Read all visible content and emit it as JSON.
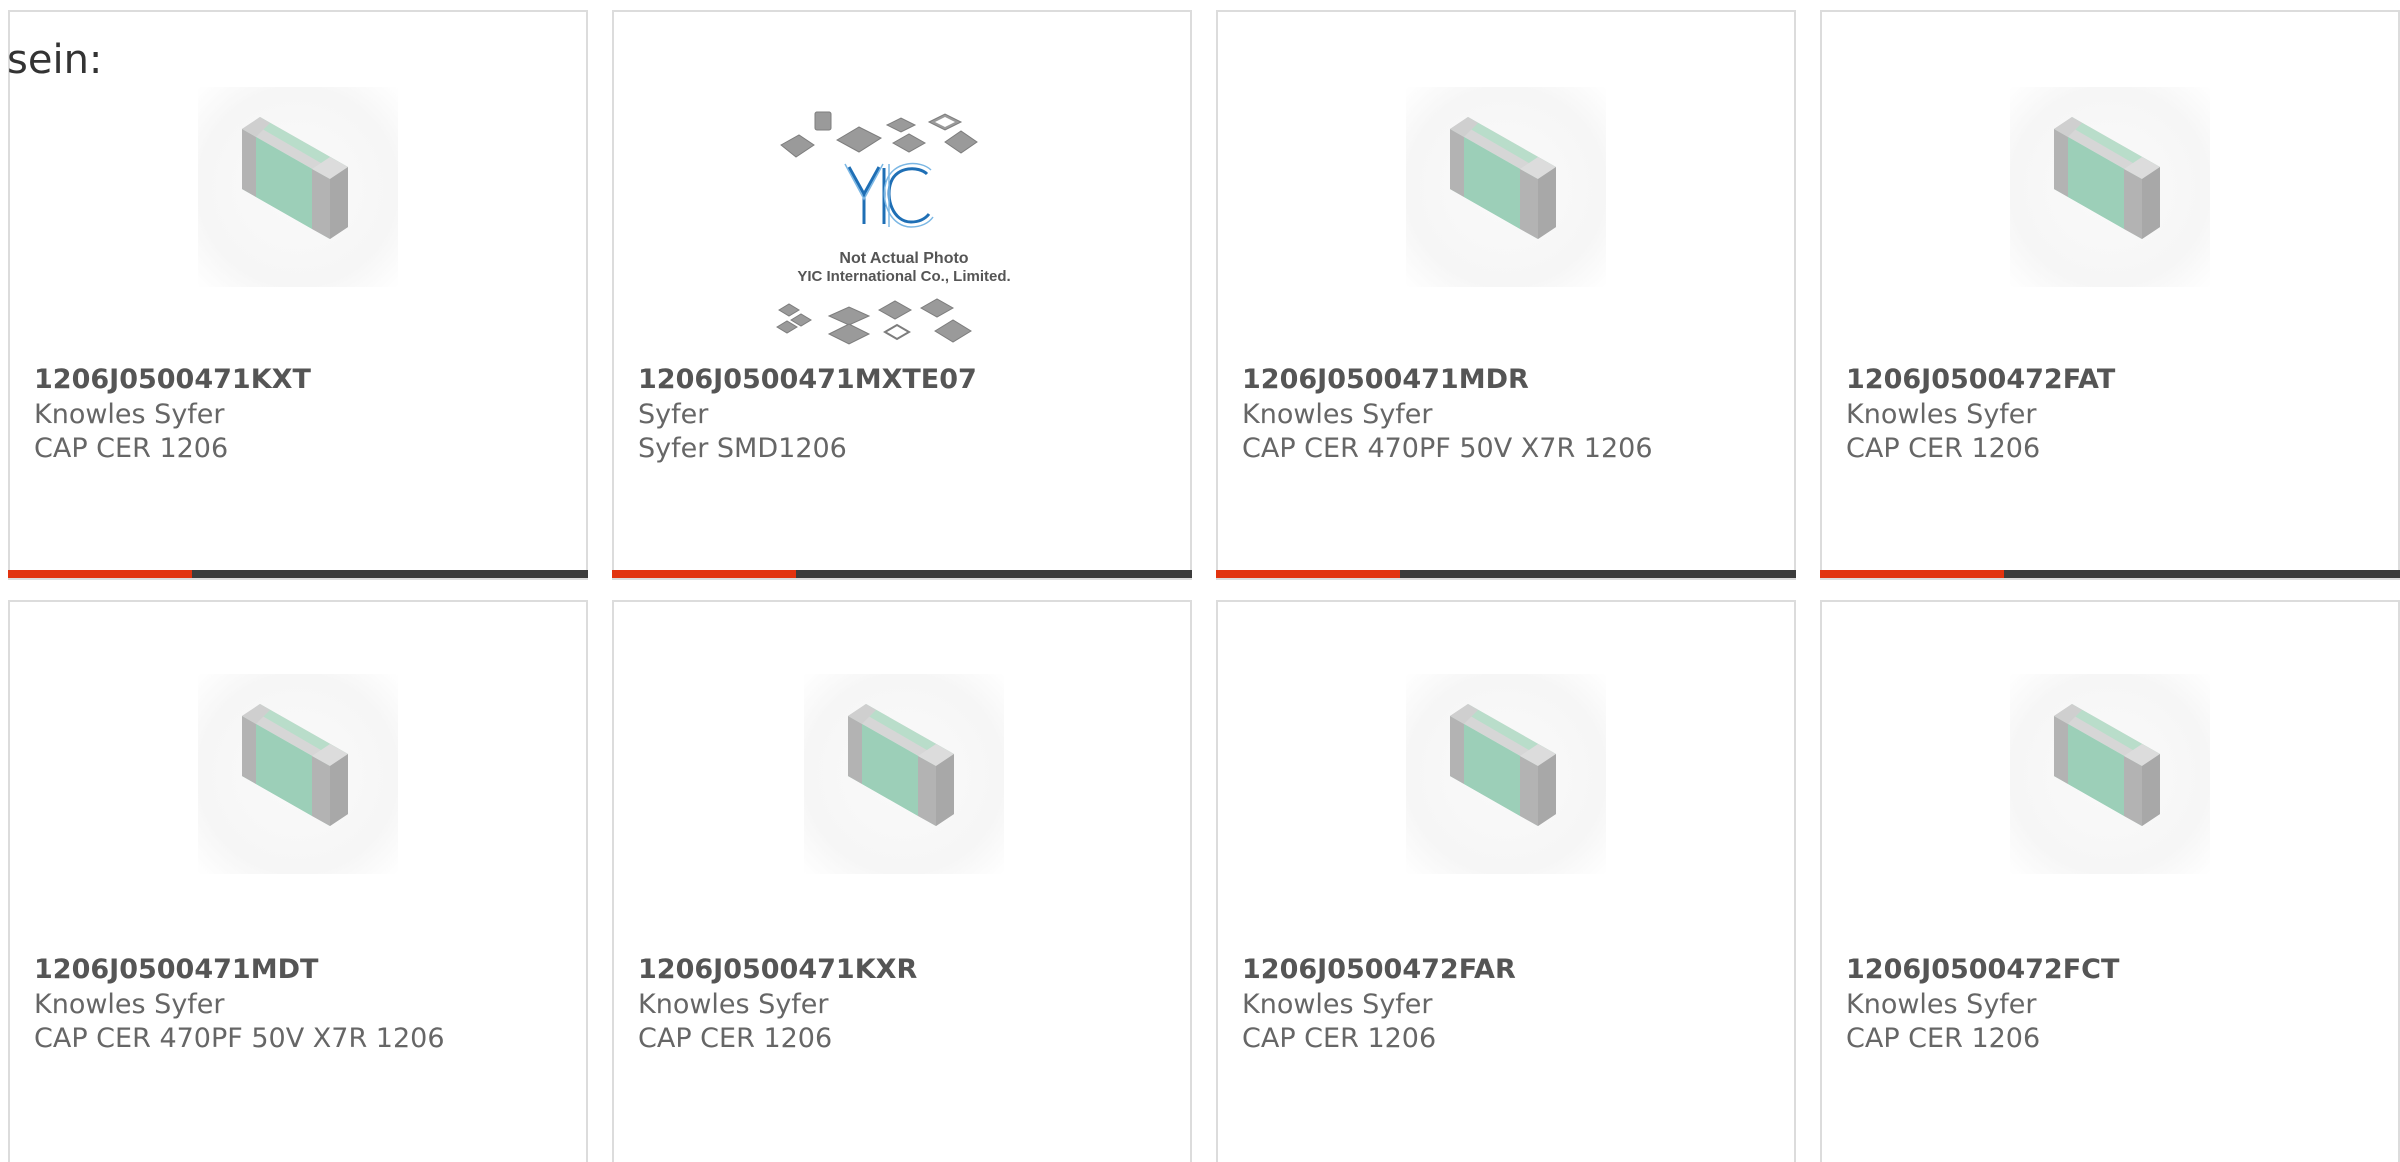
{
  "intro_text": "sein:",
  "colors": {
    "bar_highlight": "#e2330f",
    "bar_rest": "#3c3c3c",
    "card_border": "#dcdcdc",
    "title_text": "#555555",
    "body_text": "#666666",
    "chip_body": "#9ccfb8",
    "chip_terminal": "#b3b3b3"
  },
  "products": [
    {
      "part": "1206J0500471KXT",
      "maker": "Knowles Syfer",
      "desc": "CAP CER 1206",
      "image": "capacitor-chip-icon"
    },
    {
      "part": "1206J0500471MXTE07",
      "maker": "Syfer",
      "desc": "Syfer SMD1206",
      "image": "not-actual-photo-placeholder",
      "placeholder": {
        "logo": "YIC",
        "line1": "Not Actual Photo",
        "line2": "YIC International Co., Limited."
      }
    },
    {
      "part": "1206J0500471MDR",
      "maker": "Knowles Syfer",
      "desc": "CAP CER 470PF 50V X7R 1206",
      "image": "capacitor-chip-icon"
    },
    {
      "part": "1206J0500472FAT",
      "maker": "Knowles Syfer",
      "desc": "CAP CER 1206",
      "image": "capacitor-chip-icon"
    },
    {
      "part": "1206J0500471MDT",
      "maker": "Knowles Syfer",
      "desc": "CAP CER 470PF 50V X7R 1206",
      "image": "capacitor-chip-icon"
    },
    {
      "part": "1206J0500471KXR",
      "maker": "Knowles Syfer",
      "desc": "CAP CER 1206",
      "image": "capacitor-chip-icon"
    },
    {
      "part": "1206J0500472FAR",
      "maker": "Knowles Syfer",
      "desc": "CAP CER 1206",
      "image": "capacitor-chip-icon"
    },
    {
      "part": "1206J0500472FCT",
      "maker": "Knowles Syfer",
      "desc": "CAP CER 1206",
      "image": "capacitor-chip-icon"
    }
  ]
}
